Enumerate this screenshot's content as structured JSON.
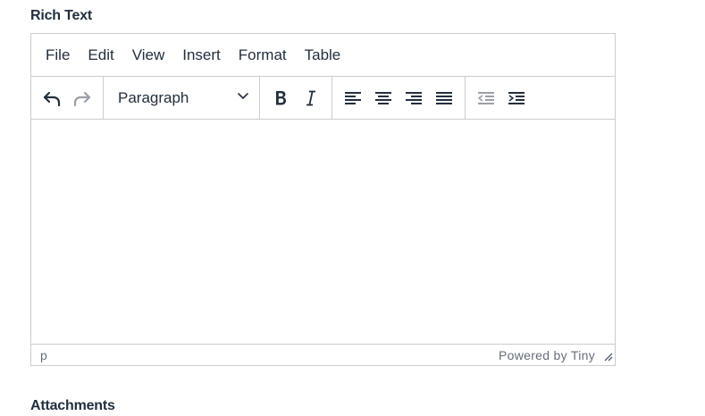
{
  "labels": {
    "rich_text": "Rich Text",
    "attachments": "Attachments"
  },
  "menubar": {
    "items": [
      "File",
      "Edit",
      "View",
      "Insert",
      "Format",
      "Table"
    ]
  },
  "toolbar": {
    "block_format": "Paragraph",
    "icons": {
      "undo": "undo-icon",
      "redo": "redo-icon",
      "bold": "bold-icon",
      "italic": "italic-icon",
      "align_left": "align-left-icon",
      "align_center": "align-center-icon",
      "align_right": "align-right-icon",
      "align_justify": "align-justify-icon",
      "outdent": "outdent-icon",
      "indent": "indent-icon"
    },
    "redo_disabled": true,
    "outdent_disabled": true
  },
  "statusbar": {
    "path": "p",
    "branding": "Powered by Tiny"
  },
  "colors": {
    "text": "#222f3e",
    "border": "#cccccc",
    "disabled": "#8b95a1"
  }
}
